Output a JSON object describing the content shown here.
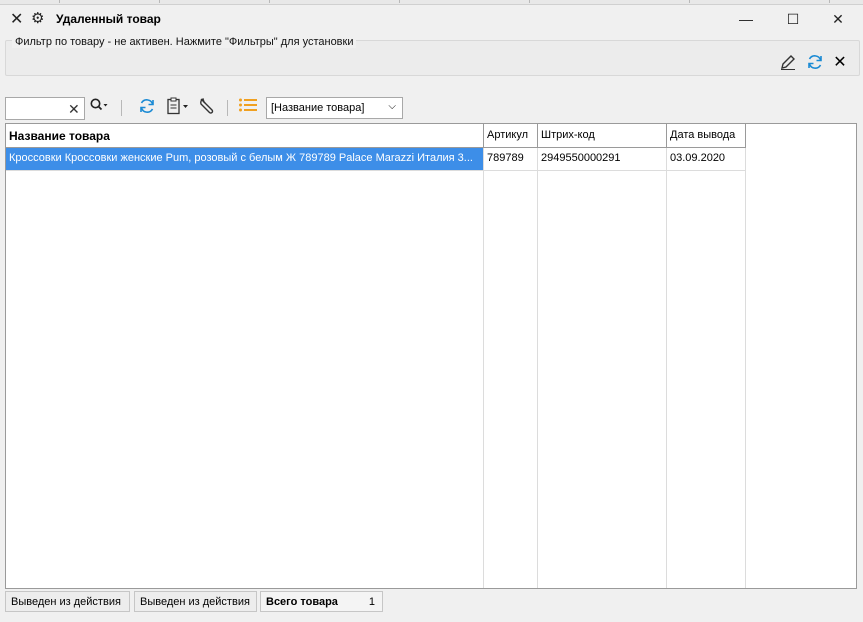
{
  "window": {
    "title": "Удаленный товар",
    "controls": {
      "minimize": "—",
      "maximize": "☐",
      "close": "✕"
    }
  },
  "filter": {
    "text": "Фильтр по товару - не активен. Нажмите \"Фильтры\" для установки"
  },
  "toolbar": {
    "search_value": "",
    "sort_field": "[Название товара]"
  },
  "table": {
    "columns": [
      "Название товара",
      "Артикул",
      "Штрих-код",
      "Дата вывода"
    ],
    "rows": [
      {
        "name": "Кроссовки Кроссовки женские Pum, розовый с белым Ж 789789 Palace Marazzi Италия 3...",
        "article": "789789",
        "barcode": "2949550000291",
        "date": "03.09.2020"
      }
    ]
  },
  "status": {
    "tab1": "Выведен из действия",
    "tab2": "Выведен из действия",
    "total_label": "Всего товара",
    "total_value": "1"
  },
  "colors": {
    "selection": "#3d8ee8",
    "accent_blue": "#1a8ad4",
    "accent_orange": "#f0a020"
  },
  "icons": [
    "close-icon",
    "gear-icon",
    "edit-pencil-icon",
    "refresh-icon",
    "clear-icon",
    "search-icon",
    "clipboard-icon",
    "wrench-icon",
    "list-icon",
    "chevron-down-icon"
  ]
}
